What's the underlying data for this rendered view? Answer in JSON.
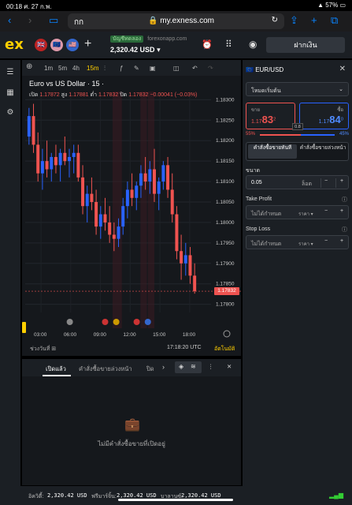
{
  "statusbar": {
    "time_date": "00:18  ศ. 27 ก.พ.",
    "battery": "57%"
  },
  "safari": {
    "aa_label": "กก",
    "url": "my.exness.com"
  },
  "header": {
    "logo": "ex",
    "account_type": "บัญชีทดลอง",
    "account_server": "forexonapp.com",
    "balance": "2,320.42 USD",
    "deposit_label": "ฝากเงิน"
  },
  "toolbar": {
    "timeframes": [
      "1m",
      "5m",
      "4h",
      "15m"
    ],
    "active": "15m"
  },
  "chart": {
    "symbol_title": "Euro vs US Dollar · 15 ·",
    "ohlc": {
      "open_label": "เปิด",
      "open": "1.17872",
      "high_label": "สูง",
      "high": "1.17881",
      "low_label": "ต่ำ",
      "low": "1.17832",
      "close_label": "ปิด",
      "close": "1.17832",
      "change": "−0.00041 (−0.03%)"
    },
    "current_price": "1.17832",
    "range_label": "ช่วงวันที่",
    "clock": "17:18:20 UTC",
    "auto_label": "อัตโนมัติ",
    "colors": {
      "up": "#2962ff",
      "down": "#ef5350",
      "bg": "#15181c"
    }
  },
  "chart_data": {
    "type": "candlestick",
    "title": "Euro vs US Dollar · 15 ·",
    "x_ticks": [
      "03:00",
      "06:00",
      "09:00",
      "12:00",
      "15:00",
      "18:00"
    ],
    "y_ticks": [
      1.183,
      1.1825,
      1.182,
      1.1815,
      1.181,
      1.1805,
      1.18,
      1.1795,
      1.179,
      1.1785,
      1.178
    ],
    "ylim": [
      1.1778,
      1.1832
    ],
    "current": 1.17832,
    "candles": [
      [
        1.1821,
        1.1828,
        1.1819,
        1.1826
      ],
      [
        1.1826,
        1.1829,
        1.1817,
        1.1819
      ],
      [
        1.1819,
        1.1822,
        1.181,
        1.1812
      ],
      [
        1.1812,
        1.1818,
        1.1808,
        1.1815
      ],
      [
        1.1815,
        1.182,
        1.1811,
        1.1813
      ],
      [
        1.1813,
        1.1817,
        1.181,
        1.1816
      ],
      [
        1.1816,
        1.1819,
        1.1812,
        1.1814
      ],
      [
        1.1814,
        1.1818,
        1.181,
        1.1817
      ],
      [
        1.1817,
        1.1821,
        1.1814,
        1.1815
      ],
      [
        1.1815,
        1.1818,
        1.1811,
        1.1816
      ],
      [
        1.1816,
        1.1819,
        1.1812,
        1.1817
      ],
      [
        1.1817,
        1.1819,
        1.181,
        1.1811
      ],
      [
        1.1811,
        1.1814,
        1.1802,
        1.1804
      ],
      [
        1.1804,
        1.1809,
        1.18,
        1.1807
      ],
      [
        1.1807,
        1.1811,
        1.1803,
        1.1805
      ],
      [
        1.1805,
        1.1808,
        1.1797,
        1.1799
      ],
      [
        1.1799,
        1.1804,
        1.1796,
        1.1802
      ],
      [
        1.1802,
        1.1806,
        1.1798,
        1.18
      ],
      [
        1.18,
        1.1804,
        1.1795,
        1.1797
      ],
      [
        1.1797,
        1.18,
        1.1793,
        1.1796
      ],
      [
        1.1796,
        1.1801,
        1.1794,
        1.1799
      ],
      [
        1.1799,
        1.1806,
        1.1797,
        1.1804
      ],
      [
        1.1804,
        1.181,
        1.1801,
        1.1808
      ],
      [
        1.1808,
        1.1812,
        1.1804,
        1.1806
      ],
      [
        1.1806,
        1.181,
        1.1803,
        1.1809
      ],
      [
        1.1809,
        1.1814,
        1.1806,
        1.1812
      ],
      [
        1.1812,
        1.1816,
        1.1808,
        1.181
      ],
      [
        1.181,
        1.1815,
        1.1807,
        1.1813
      ],
      [
        1.1813,
        1.1818,
        1.1805,
        1.1807
      ],
      [
        1.1807,
        1.1811,
        1.1803,
        1.181
      ],
      [
        1.181,
        1.1815,
        1.1808,
        1.1814
      ],
      [
        1.1814,
        1.1816,
        1.1806,
        1.1808
      ],
      [
        1.1808,
        1.1812,
        1.18,
        1.1802
      ],
      [
        1.1802,
        1.1804,
        1.1791,
        1.1793
      ],
      [
        1.1793,
        1.1797,
        1.1786,
        1.179
      ],
      [
        1.179,
        1.1795,
        1.1787,
        1.1792
      ],
      [
        1.1792,
        1.1794,
        1.1785,
        1.1787
      ],
      [
        1.1787,
        1.179,
        1.17826,
        1.17832
      ]
    ]
  },
  "order_panel": {
    "symbol": "EUR/USD",
    "mode": "โหมดเริ่มต้น",
    "sell_label": "ขาย",
    "sell_price_main": "1.17",
    "sell_price_big": "83",
    "sell_price_frac": "2",
    "buy_label": "ซื้อ",
    "buy_price_main": "1.17",
    "buy_price_big": "84",
    "buy_price_frac": "0",
    "spread": "0.8",
    "sell_pct": "55%",
    "buy_pct": "45%",
    "tab_market": "คำสั่งซื้อขายทันที",
    "tab_pending": "คำสั่งซื้อขายล่วงหน้า",
    "volume_label": "ขนาด",
    "volume": "0.05",
    "volume_unit": "ล็อต",
    "tp_label": "Take Profit",
    "tp_value": "ไม่ได้กำหนด",
    "tp_unit": "ราคา",
    "sl_label": "Stop Loss",
    "sl_value": "ไม่ได้กำหนด",
    "sl_unit": "ราคา"
  },
  "bottom": {
    "tabs": [
      "เปิดแล้ว",
      "คำสั่งซื้อขายล่วงหน้า",
      "ปิด"
    ],
    "empty_text": "ไม่มีคำสั่งซื้อขายที่เปิดอยู่"
  },
  "footer": {
    "equity_label": "อิควิตี้:",
    "equity": "2,320.42 USD",
    "free_margin_label": "ฟรีมาร์จิ้น:",
    "free_margin": "2,320.42 USD",
    "balance_label": "บาลานซ์:",
    "balance": "2,320.42 USD"
  }
}
